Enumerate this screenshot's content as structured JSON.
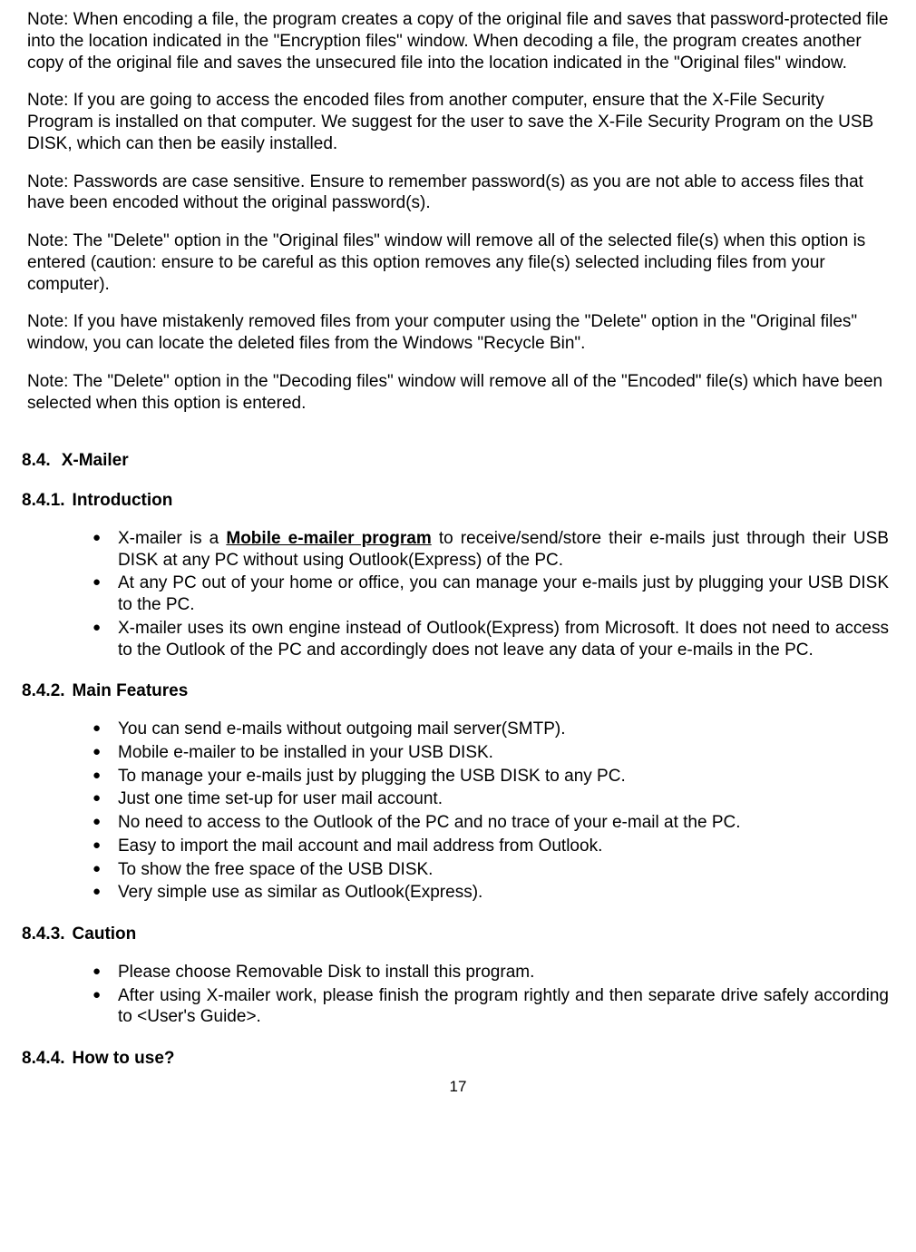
{
  "notes": [
    "Note: When encoding a file, the program creates a copy of the original file and saves that password-protected file into the location indicated in the \"Encryption files\" window. When decoding a file, the program creates another copy of the original file and saves the unsecured file into the location indicated in the \"Original files\" window.",
    "Note: If you are going to access the encoded files from another computer, ensure that the X-File Security Program is installed on that computer. We suggest for the user to save the X-File Security Program on the USB DISK, which can then be easily installed.",
    "Note: Passwords are case sensitive. Ensure to remember password(s) as you are not able to access files that have been encoded without the original password(s).",
    "Note: The \"Delete\" option in the \"Original files\" window will remove all of the selected file(s) when this option is entered (caution: ensure to be careful as this option removes any file(s) selected including files from your computer).",
    "Note: If you have mistakenly removed files from your computer using the \"Delete\" option in the \"Original files\" window, you can locate the deleted files from the Windows \"Recycle Bin\".",
    "Note: The \"Delete\" option in the \"Decoding files\" window will remove all of the \"Encoded\" file(s) which have been selected when this option is entered."
  ],
  "section84": {
    "number": "8.4.",
    "title": "X-Mailer"
  },
  "section841": {
    "number": "8.4.1.",
    "title": "Introduction",
    "intro_prefix": "X-mailer is a ",
    "intro_bold": "Mobile e-mailer program",
    "intro_suffix": " to receive/send/store their e-mails just through their USB DISK at any PC without using Outlook(Express) of the PC.",
    "bullets": [
      "At any PC out of your home or office, you can manage your e-mails just by plugging your USB DISK to the PC.",
      "X-mailer uses its own engine instead of Outlook(Express) from Microsoft. It does not need to access to the Outlook of the PC and accordingly does not leave any data of your e-mails in the PC."
    ]
  },
  "section842": {
    "number": "8.4.2.",
    "title": "Main Features",
    "bullets": [
      "You can send e-mails without outgoing mail server(SMTP).",
      "Mobile e-mailer to be installed in your USB DISK.",
      "To manage your e-mails just by plugging the USB DISK to any PC.",
      "Just one time set-up for user mail account.",
      "No need to access to the Outlook of the PC and no trace of your e-mail at the PC.",
      "Easy to import the mail account and mail address from Outlook.",
      "To show the free space of the USB DISK.",
      "Very simple use as similar as Outlook(Express)."
    ]
  },
  "section843": {
    "number": "8.4.3.",
    "title": "Caution",
    "bullets": [
      "Please choose Removable Disk to install this program.",
      "After using X-mailer work, please finish the program rightly and then separate drive safely according to <User's Guide>."
    ]
  },
  "section844": {
    "number": "8.4.4.",
    "title": "How to use?"
  },
  "pageNumber": "17"
}
